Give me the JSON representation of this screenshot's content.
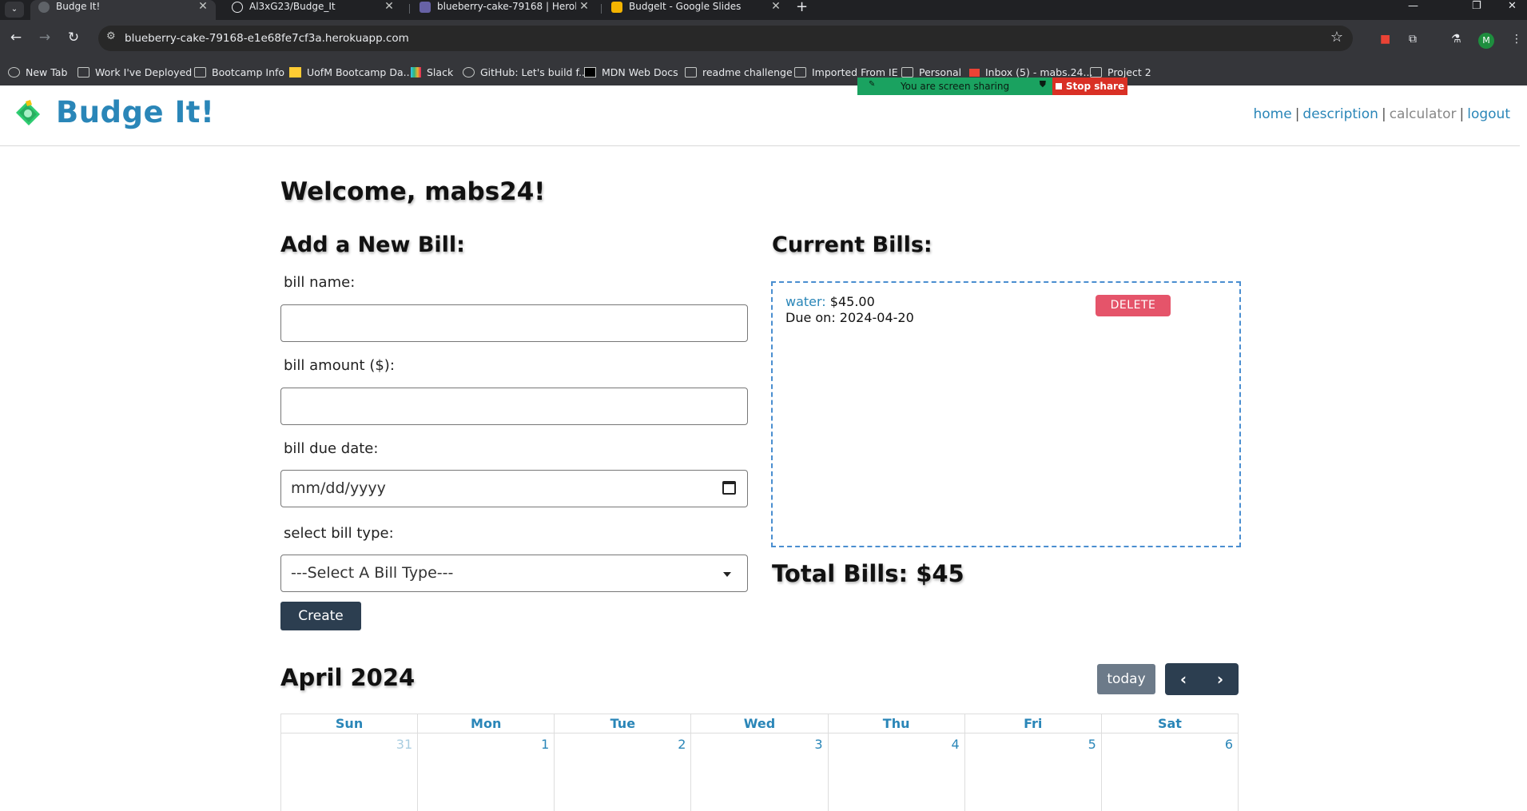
{
  "browser": {
    "tabs": [
      {
        "title": "Budge It!",
        "active": true
      },
      {
        "title": "Al3xG23/Budge_It",
        "active": false
      },
      {
        "title": "blueberry-cake-79168 | Heroku",
        "active": false
      },
      {
        "title": "BudgeIt - Google Slides",
        "active": false
      }
    ],
    "url": "blueberry-cake-79168-e1e68fe7cf3a.herokuapp.com",
    "profile_initial": "M",
    "bookmarks": [
      {
        "label": "New Tab",
        "icon": "globe-icon"
      },
      {
        "label": "Work I've Deployed",
        "icon": "folder-icon"
      },
      {
        "label": "Bootcamp Info",
        "icon": "folder-icon"
      },
      {
        "label": "UofM Bootcamp Da...",
        "icon": "uofm-icon"
      },
      {
        "label": "Slack",
        "icon": "slack-icon"
      },
      {
        "label": "GitHub: Let's build f...",
        "icon": "github-icon"
      },
      {
        "label": "MDN Web Docs",
        "icon": "mdn-icon"
      },
      {
        "label": "readme challenge",
        "icon": "folder-icon"
      },
      {
        "label": "Imported From IE",
        "icon": "folder-icon"
      },
      {
        "label": "Personal",
        "icon": "folder-icon"
      },
      {
        "label": "Inbox (5) - mabs.24...",
        "icon": "gmail-icon"
      },
      {
        "label": "Project 2",
        "icon": "folder-icon"
      }
    ],
    "screen_share": {
      "status": "You are screen sharing",
      "stop_label": "Stop share"
    }
  },
  "site": {
    "brand": "Budge It!",
    "nav": [
      {
        "label": "home"
      },
      {
        "label": "description"
      },
      {
        "label": "calculator"
      },
      {
        "label": "logout"
      }
    ],
    "nav_sep": "|",
    "accent_color": "#2a86b8"
  },
  "main": {
    "welcome": "Welcome, mabs24!",
    "form": {
      "heading": "Add a New Bill:",
      "name_label": "bill name:",
      "name_value": "",
      "amount_label": "bill amount ($):",
      "amount_value": "",
      "date_label": "bill due date:",
      "date_placeholder": "mm/dd/yyyy",
      "type_label": "select bill type:",
      "type_selected": "---Select A Bill Type---",
      "create_label": "Create"
    },
    "bills": {
      "heading": "Current Bills:",
      "items": [
        {
          "name": "water:",
          "amount": "$45.00",
          "due": "Due on: 2024-04-20",
          "delete_label": "DELETE"
        }
      ],
      "total": "Total Bills: $45"
    },
    "calendar": {
      "title": "April 2024",
      "today_label": "today",
      "prev_icon": "chevron-left-icon",
      "next_icon": "chevron-right-icon",
      "weekdays": [
        "Sun",
        "Mon",
        "Tue",
        "Wed",
        "Thu",
        "Fri",
        "Sat"
      ],
      "first_row": [
        "31",
        "1",
        "2",
        "3",
        "4",
        "5",
        "6"
      ]
    }
  }
}
